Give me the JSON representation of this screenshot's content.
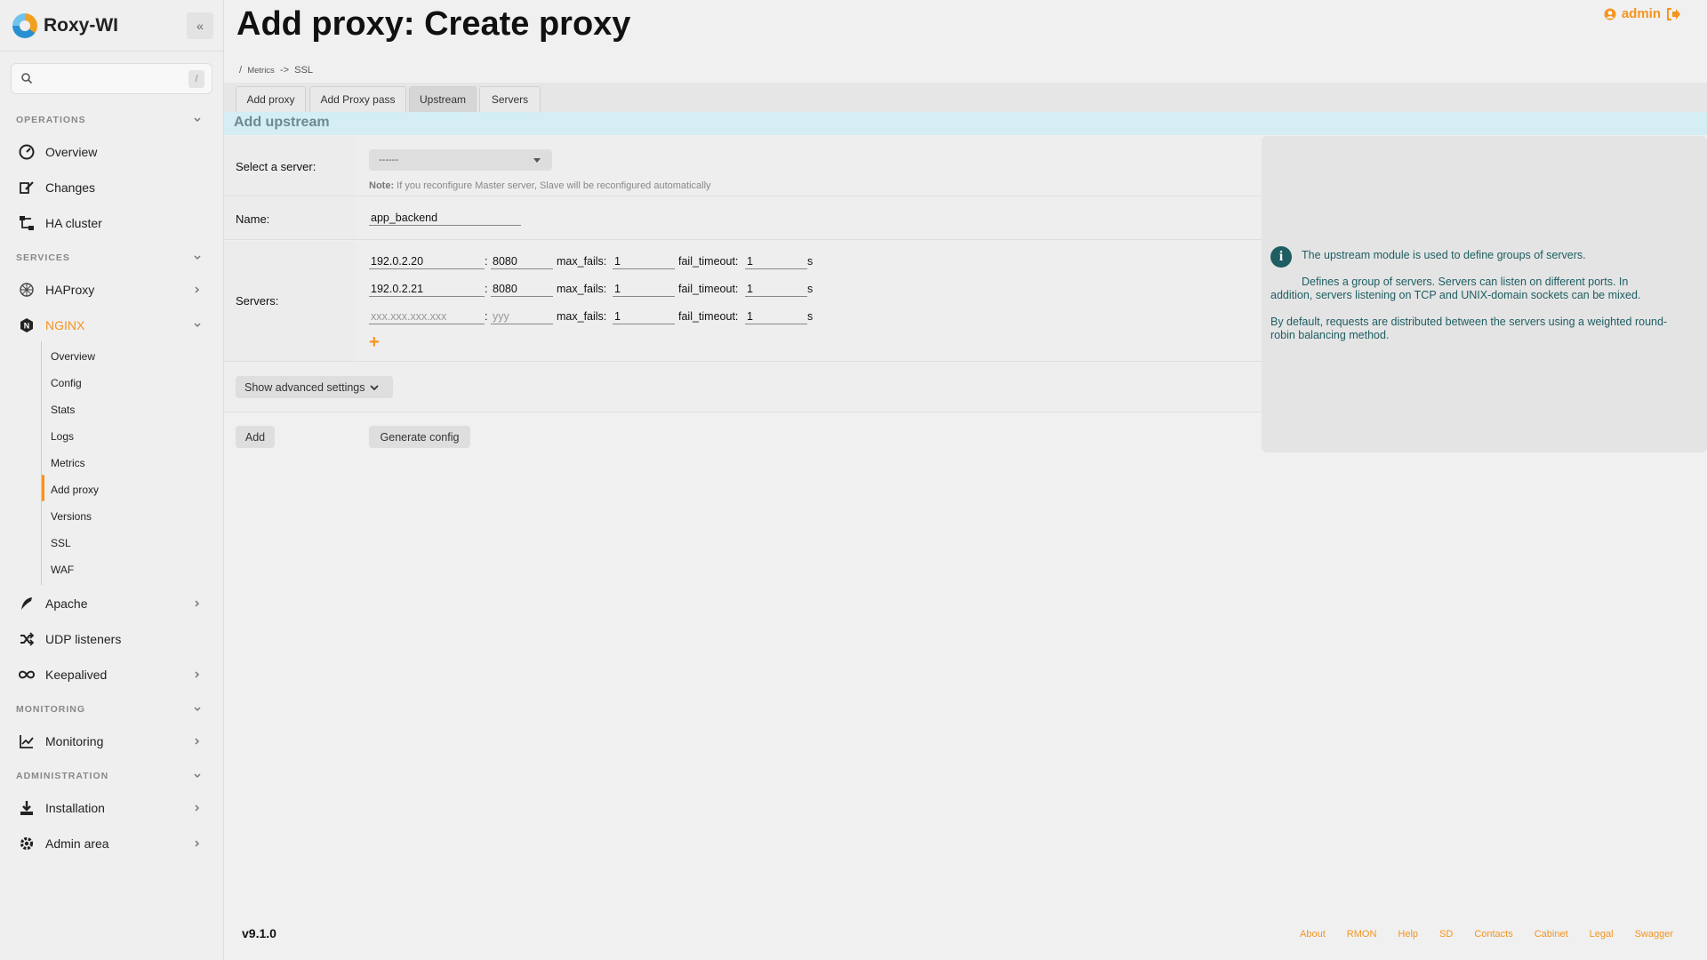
{
  "app": {
    "name": "Roxy-WI"
  },
  "search": {
    "placeholder": "",
    "shortcut": "/"
  },
  "sidebar": {
    "sections": [
      {
        "label": "OPERATIONS"
      },
      {
        "label": "SERVICES"
      },
      {
        "label": "MONITORING"
      },
      {
        "label": "ADMINISTRATION"
      }
    ],
    "items": [
      {
        "label": "Overview"
      },
      {
        "label": "Changes"
      },
      {
        "label": "HA cluster"
      },
      {
        "label": "HAProxy"
      },
      {
        "label": "NGINX"
      },
      {
        "label": "Apache"
      },
      {
        "label": "UDP listeners"
      },
      {
        "label": "Keepalived"
      },
      {
        "label": "Monitoring"
      },
      {
        "label": "Installation"
      },
      {
        "label": "Admin area"
      }
    ],
    "nginx_sub": [
      "Overview",
      "Config",
      "Stats",
      "Logs",
      "Metrics",
      "Add proxy",
      "Versions",
      "SSL",
      "WAF"
    ]
  },
  "header": {
    "title": "Add proxy: Create proxy",
    "user": "admin",
    "breadcrumb": {
      "sep": "/",
      "part1": "Metrics",
      "arrow": "->",
      "part2": "SSL"
    }
  },
  "tabs": [
    {
      "label": "Add proxy"
    },
    {
      "label": "Add Proxy pass"
    },
    {
      "label": "Upstream"
    },
    {
      "label": "Servers"
    }
  ],
  "form": {
    "header": "Add upstream",
    "select_label": "Select a server:",
    "select_value": "------",
    "note_bold": "Note:",
    "note_text": " If you reconfigure Master server, Slave will be reconfigured automatically",
    "name_label": "Name:",
    "name_value": "app_backend",
    "servers_label": "Servers:",
    "colon": ":",
    "max_fails_label": "max_fails:",
    "fail_timeout_label": "fail_timeout:",
    "seconds": "s",
    "servers": [
      {
        "ip": "192.0.2.20",
        "port": "8080",
        "max_fails": "1",
        "fail_timeout": "1"
      },
      {
        "ip": "192.0.2.21",
        "port": "8080",
        "max_fails": "1",
        "fail_timeout": "1"
      },
      {
        "ip": "",
        "port": "",
        "max_fails": "1",
        "fail_timeout": "1"
      }
    ],
    "ip_placeholder": "xxx.xxx.xxx.xxx",
    "port_placeholder": "yyy",
    "advanced_label": "Show advanced settings",
    "add_label": "Add",
    "generate_label": "Generate config"
  },
  "info": {
    "line1": "The upstream module is used to define groups of servers.",
    "para1a": "Defines a group of servers. Servers can listen on different ports. In",
    "para1b": "addition, servers listening on TCP and UNIX-domain sockets can be mixed.",
    "para2a": "By default, requests are distributed between the servers using a weighted round-",
    "para2b": "robin balancing method."
  },
  "footer": {
    "version": "v9.1.0",
    "links": [
      "About",
      "RMON",
      "Help",
      "SD",
      "Contacts",
      "Cabinet",
      "Legal",
      "Swagger"
    ]
  },
  "colors": {
    "accent": "#f39521",
    "info_text": "#1e5e62",
    "form_header_bg": "#d4eef3"
  }
}
